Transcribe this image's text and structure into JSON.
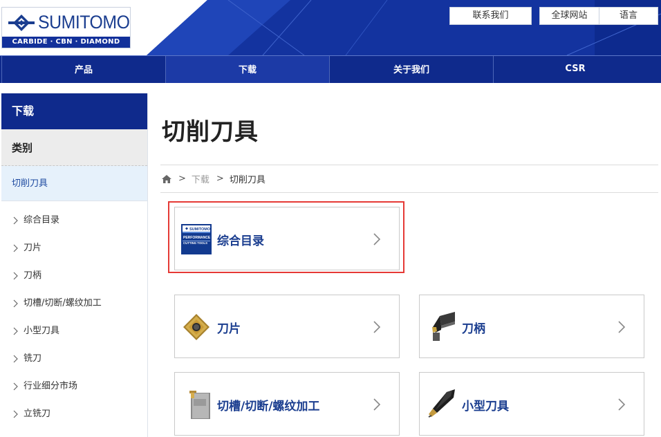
{
  "header": {
    "logo_text": "SUMITOMO",
    "logo_sub": "CARBIDE · CBN · DIAMOND",
    "links": {
      "contact": "联系我们",
      "global": "全球网站",
      "language": "语言"
    }
  },
  "nav": {
    "items": [
      "产品",
      "下载",
      "关于我们",
      "CSR"
    ]
  },
  "sidebar": {
    "heading": "下载",
    "category": "类别",
    "active": "切削刀具",
    "items": [
      "综合目录",
      "刀片",
      "刀柄",
      "切槽/切断/螺纹加工",
      "小型刀具",
      "铣刀",
      "行业细分市场",
      "立铣刀"
    ]
  },
  "main": {
    "title": "切削刀具",
    "breadcrumb": {
      "link": "下载",
      "current": "切削刀具",
      "sep": ">"
    },
    "cards": [
      {
        "label": "综合目录",
        "icon": "catalog-thumbnail"
      },
      {
        "label": "刀片",
        "icon": "insert-thumbnail"
      },
      {
        "label": "刀柄",
        "icon": "holder-thumbnail"
      },
      {
        "label": "切槽/切断/螺纹加工",
        "icon": "grooving-thumbnail"
      },
      {
        "label": "小型刀具",
        "icon": "small-tool-thumbnail"
      }
    ],
    "catalog_thumb": {
      "brand": "SUMITOMO",
      "line1": "PERFORMANCE",
      "line2": "CUTTING TOOLS"
    }
  },
  "colors": {
    "brand_blue": "#0f2a8c",
    "link_blue": "#1a3d8f",
    "highlight_red": "#e53935",
    "active_bg": "#e6f1fb"
  }
}
